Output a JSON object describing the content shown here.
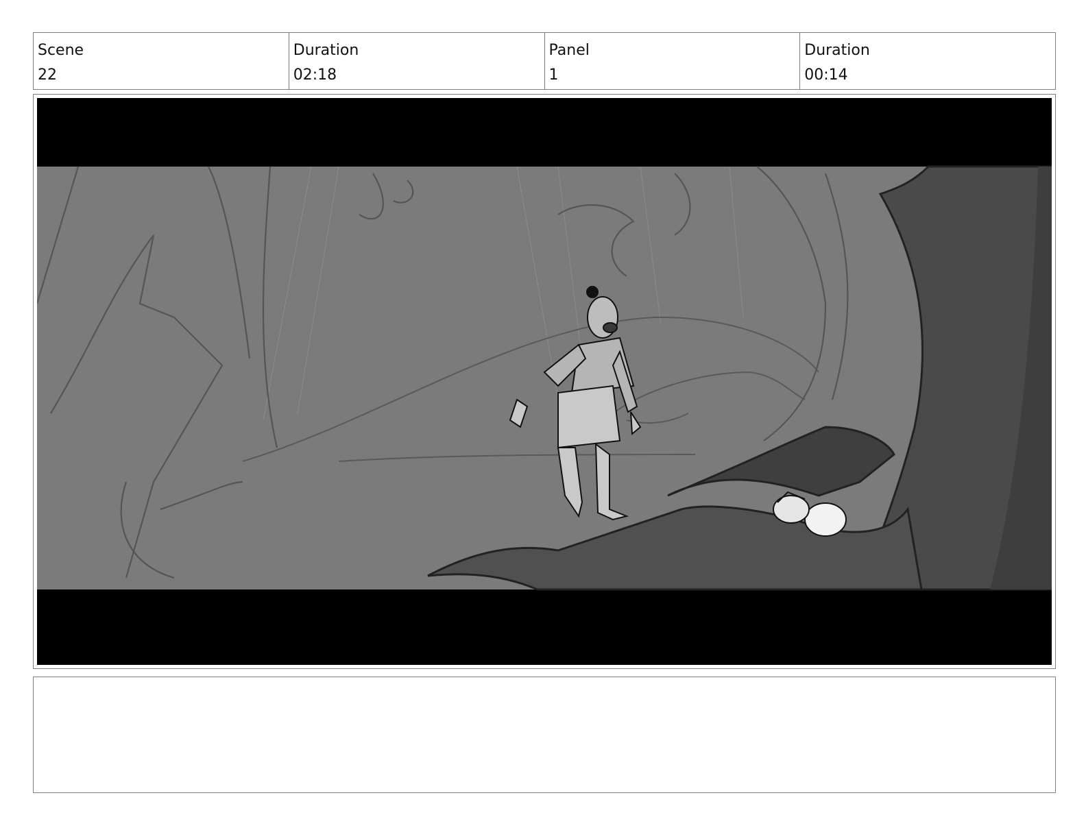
{
  "header": {
    "scene_label": "Scene",
    "scene_value": "22",
    "scene_duration_label": "Duration",
    "scene_duration_value": "02:18",
    "panel_label": "Panel",
    "panel_value": "1",
    "panel_duration_label": "Duration",
    "panel_duration_value": "00:14"
  },
  "panel": {
    "image_semantic": "storyboard-sketch-forest-scene",
    "letterbox_color": "#000000",
    "background_color": "#7a7a7a",
    "tree_color": "#4a4a4a"
  },
  "notes": {
    "text": ""
  }
}
